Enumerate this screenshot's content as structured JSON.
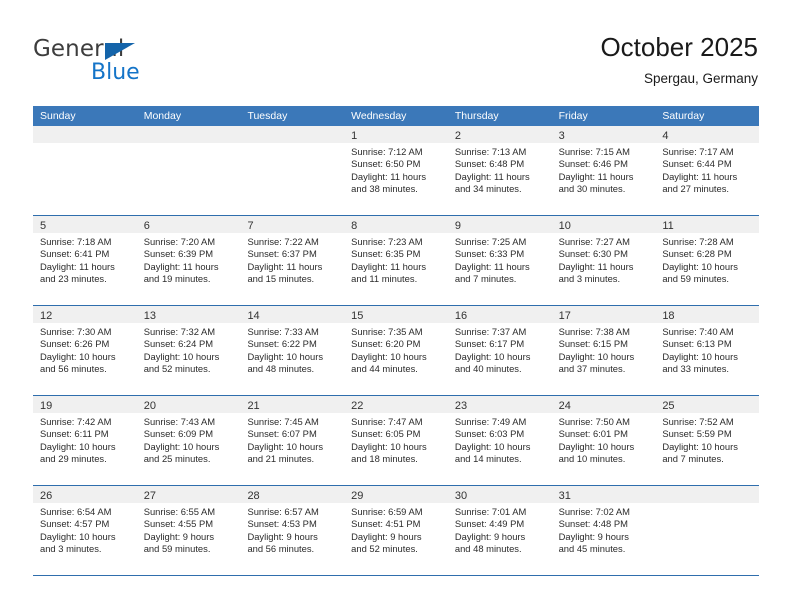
{
  "brand": {
    "name_top": "General",
    "name_bottom": "Blue",
    "triangle_color": "#1464aa",
    "blue_color": "#1474c8"
  },
  "header": {
    "title": "October 2025",
    "subtitle": "Spergau, Germany"
  },
  "theme": {
    "header_row_bg": "#3b78b9",
    "row_divider": "#2f6ead",
    "day_band_bg": "#f0f0f0"
  },
  "weekdays": [
    "Sunday",
    "Monday",
    "Tuesday",
    "Wednesday",
    "Thursday",
    "Friday",
    "Saturday"
  ],
  "weeks": [
    [
      {
        "day": "",
        "lines": []
      },
      {
        "day": "",
        "lines": []
      },
      {
        "day": "",
        "lines": []
      },
      {
        "day": "1",
        "lines": [
          "Sunrise: 7:12 AM",
          "Sunset: 6:50 PM",
          "Daylight: 11 hours",
          "and 38 minutes."
        ]
      },
      {
        "day": "2",
        "lines": [
          "Sunrise: 7:13 AM",
          "Sunset: 6:48 PM",
          "Daylight: 11 hours",
          "and 34 minutes."
        ]
      },
      {
        "day": "3",
        "lines": [
          "Sunrise: 7:15 AM",
          "Sunset: 6:46 PM",
          "Daylight: 11 hours",
          "and 30 minutes."
        ]
      },
      {
        "day": "4",
        "lines": [
          "Sunrise: 7:17 AM",
          "Sunset: 6:44 PM",
          "Daylight: 11 hours",
          "and 27 minutes."
        ]
      }
    ],
    [
      {
        "day": "5",
        "lines": [
          "Sunrise: 7:18 AM",
          "Sunset: 6:41 PM",
          "Daylight: 11 hours",
          "and 23 minutes."
        ]
      },
      {
        "day": "6",
        "lines": [
          "Sunrise: 7:20 AM",
          "Sunset: 6:39 PM",
          "Daylight: 11 hours",
          "and 19 minutes."
        ]
      },
      {
        "day": "7",
        "lines": [
          "Sunrise: 7:22 AM",
          "Sunset: 6:37 PM",
          "Daylight: 11 hours",
          "and 15 minutes."
        ]
      },
      {
        "day": "8",
        "lines": [
          "Sunrise: 7:23 AM",
          "Sunset: 6:35 PM",
          "Daylight: 11 hours",
          "and 11 minutes."
        ]
      },
      {
        "day": "9",
        "lines": [
          "Sunrise: 7:25 AM",
          "Sunset: 6:33 PM",
          "Daylight: 11 hours",
          "and 7 minutes."
        ]
      },
      {
        "day": "10",
        "lines": [
          "Sunrise: 7:27 AM",
          "Sunset: 6:30 PM",
          "Daylight: 11 hours",
          "and 3 minutes."
        ]
      },
      {
        "day": "11",
        "lines": [
          "Sunrise: 7:28 AM",
          "Sunset: 6:28 PM",
          "Daylight: 10 hours",
          "and 59 minutes."
        ]
      }
    ],
    [
      {
        "day": "12",
        "lines": [
          "Sunrise: 7:30 AM",
          "Sunset: 6:26 PM",
          "Daylight: 10 hours",
          "and 56 minutes."
        ]
      },
      {
        "day": "13",
        "lines": [
          "Sunrise: 7:32 AM",
          "Sunset: 6:24 PM",
          "Daylight: 10 hours",
          "and 52 minutes."
        ]
      },
      {
        "day": "14",
        "lines": [
          "Sunrise: 7:33 AM",
          "Sunset: 6:22 PM",
          "Daylight: 10 hours",
          "and 48 minutes."
        ]
      },
      {
        "day": "15",
        "lines": [
          "Sunrise: 7:35 AM",
          "Sunset: 6:20 PM",
          "Daylight: 10 hours",
          "and 44 minutes."
        ]
      },
      {
        "day": "16",
        "lines": [
          "Sunrise: 7:37 AM",
          "Sunset: 6:17 PM",
          "Daylight: 10 hours",
          "and 40 minutes."
        ]
      },
      {
        "day": "17",
        "lines": [
          "Sunrise: 7:38 AM",
          "Sunset: 6:15 PM",
          "Daylight: 10 hours",
          "and 37 minutes."
        ]
      },
      {
        "day": "18",
        "lines": [
          "Sunrise: 7:40 AM",
          "Sunset: 6:13 PM",
          "Daylight: 10 hours",
          "and 33 minutes."
        ]
      }
    ],
    [
      {
        "day": "19",
        "lines": [
          "Sunrise: 7:42 AM",
          "Sunset: 6:11 PM",
          "Daylight: 10 hours",
          "and 29 minutes."
        ]
      },
      {
        "day": "20",
        "lines": [
          "Sunrise: 7:43 AM",
          "Sunset: 6:09 PM",
          "Daylight: 10 hours",
          "and 25 minutes."
        ]
      },
      {
        "day": "21",
        "lines": [
          "Sunrise: 7:45 AM",
          "Sunset: 6:07 PM",
          "Daylight: 10 hours",
          "and 21 minutes."
        ]
      },
      {
        "day": "22",
        "lines": [
          "Sunrise: 7:47 AM",
          "Sunset: 6:05 PM",
          "Daylight: 10 hours",
          "and 18 minutes."
        ]
      },
      {
        "day": "23",
        "lines": [
          "Sunrise: 7:49 AM",
          "Sunset: 6:03 PM",
          "Daylight: 10 hours",
          "and 14 minutes."
        ]
      },
      {
        "day": "24",
        "lines": [
          "Sunrise: 7:50 AM",
          "Sunset: 6:01 PM",
          "Daylight: 10 hours",
          "and 10 minutes."
        ]
      },
      {
        "day": "25",
        "lines": [
          "Sunrise: 7:52 AM",
          "Sunset: 5:59 PM",
          "Daylight: 10 hours",
          "and 7 minutes."
        ]
      }
    ],
    [
      {
        "day": "26",
        "lines": [
          "Sunrise: 6:54 AM",
          "Sunset: 4:57 PM",
          "Daylight: 10 hours",
          "and 3 minutes."
        ]
      },
      {
        "day": "27",
        "lines": [
          "Sunrise: 6:55 AM",
          "Sunset: 4:55 PM",
          "Daylight: 9 hours",
          "and 59 minutes."
        ]
      },
      {
        "day": "28",
        "lines": [
          "Sunrise: 6:57 AM",
          "Sunset: 4:53 PM",
          "Daylight: 9 hours",
          "and 56 minutes."
        ]
      },
      {
        "day": "29",
        "lines": [
          "Sunrise: 6:59 AM",
          "Sunset: 4:51 PM",
          "Daylight: 9 hours",
          "and 52 minutes."
        ]
      },
      {
        "day": "30",
        "lines": [
          "Sunrise: 7:01 AM",
          "Sunset: 4:49 PM",
          "Daylight: 9 hours",
          "and 48 minutes."
        ]
      },
      {
        "day": "31",
        "lines": [
          "Sunrise: 7:02 AM",
          "Sunset: 4:48 PM",
          "Daylight: 9 hours",
          "and 45 minutes."
        ]
      },
      {
        "day": "",
        "lines": []
      }
    ]
  ]
}
